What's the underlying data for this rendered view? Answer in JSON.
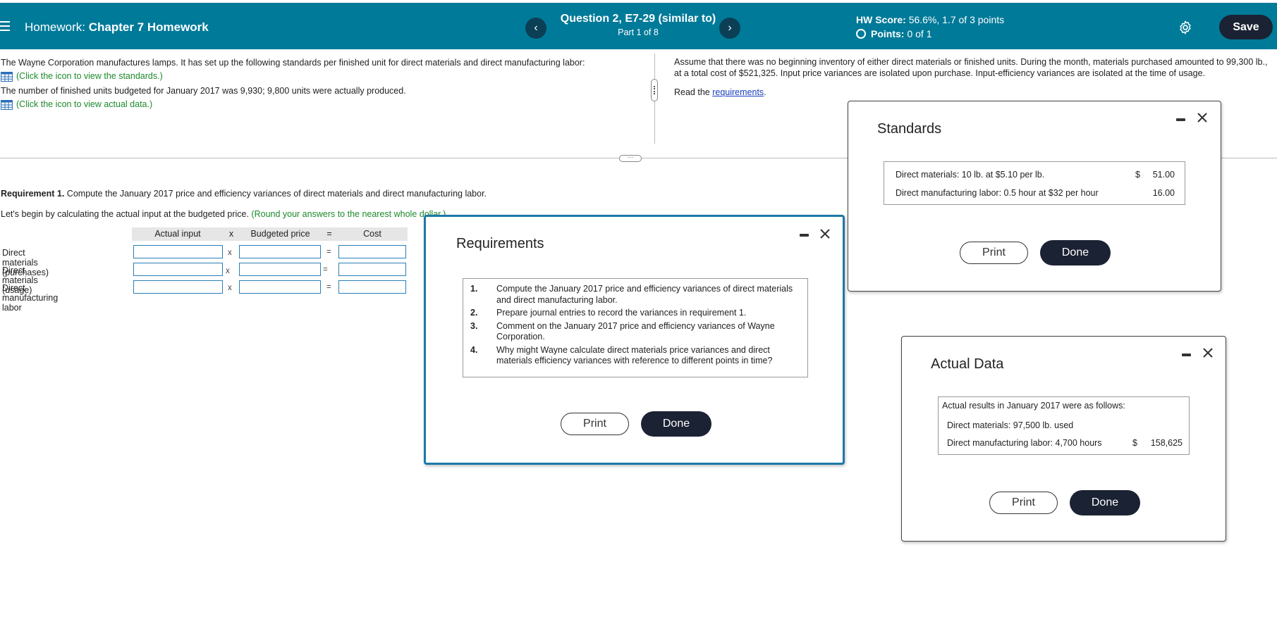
{
  "header": {
    "prefix": "Homework:",
    "title": "Chapter 7 Homework",
    "question_title": "Question 2, E7-29 (similar to)",
    "question_part": "Part 1 of 8",
    "score_label": "HW Score:",
    "score_value": "56.6%, 1.7 of 3 points",
    "points_label": "Points:",
    "points_value": "0 of 1",
    "prev": "‹",
    "next": "›",
    "save": "Save",
    "accent": "#007a99"
  },
  "question": {
    "line1": "The Wayne Corporation manufactures lamps. It has set up the following standards per finished unit for direct materials and direct manufacturing labor:",
    "standards_link": "(Click the icon to view the standards.)",
    "line2": "The number of finished units budgeted for January 2017 was 9,930; 9,800 units were actually produced.",
    "actual_link": "(Click the icon to view actual data.)",
    "right_text": "Assume that there was no beginning inventory of either direct materials or finished units. During the month, materials purchased amounted to 99,300 lb., at a total cost of $521,325. Input price variances are isolated upon purchase. Input-efficiency variances are isolated at the time of usage.",
    "read_prefix": "Read the",
    "read_link": "requirements",
    "read_suffix": "."
  },
  "requirement": {
    "label": "Requirement 1.",
    "text": "Compute the January 2017 price and efficiency variances of direct materials and direct manufacturing labor.",
    "begin": "Let's begin by calculating the actual input at the budgeted price.",
    "hint": "(Round your answers to the nearest whole dollar.)"
  },
  "calc": {
    "headers": [
      "Actual input",
      "x",
      "Budgeted price",
      "=",
      "Cost"
    ],
    "rows": [
      {
        "label": "Direct materials (purchases)",
        "x": "x",
        "eq": "="
      },
      {
        "label": "Direct materials (usage)",
        "x": "x",
        "eq": "="
      },
      {
        "label": "Direct manufacturing labor",
        "x": "x",
        "eq": "="
      }
    ]
  },
  "requirements_dialog": {
    "title": "Requirements",
    "items": [
      {
        "num": "1.",
        "text": "Compute the January 2017 price and efficiency variances of direct materials and direct manufacturing labor."
      },
      {
        "num": "2.",
        "text": "Prepare journal entries to record the variances in requirement 1."
      },
      {
        "num": "3.",
        "text": "Comment on the January 2017 price and efficiency variances of Wayne Corporation."
      },
      {
        "num": "4.",
        "text": "Why might Wayne calculate direct materials price variances and direct materials efficiency variances with reference to different points in time?"
      }
    ],
    "print": "Print",
    "done": "Done"
  },
  "standards_dialog": {
    "title": "Standards",
    "rows": [
      {
        "label": "Direct materials: 10 lb. at $5.10 per lb.",
        "currency": "$",
        "value": "51.00"
      },
      {
        "label": "Direct manufacturing labor: 0.5 hour at $32 per hour",
        "currency": "",
        "value": "16.00"
      }
    ],
    "print": "Print",
    "done": "Done"
  },
  "actual_dialog": {
    "title": "Actual Data",
    "intro": "Actual results in January 2017 were as follows:",
    "rows": [
      {
        "label": "Direct materials: 97,500 lb. used",
        "currency": "",
        "value": ""
      },
      {
        "label": "Direct manufacturing labor: 4,700 hours",
        "currency": "$",
        "value": "158,625"
      }
    ],
    "print": "Print",
    "done": "Done"
  }
}
